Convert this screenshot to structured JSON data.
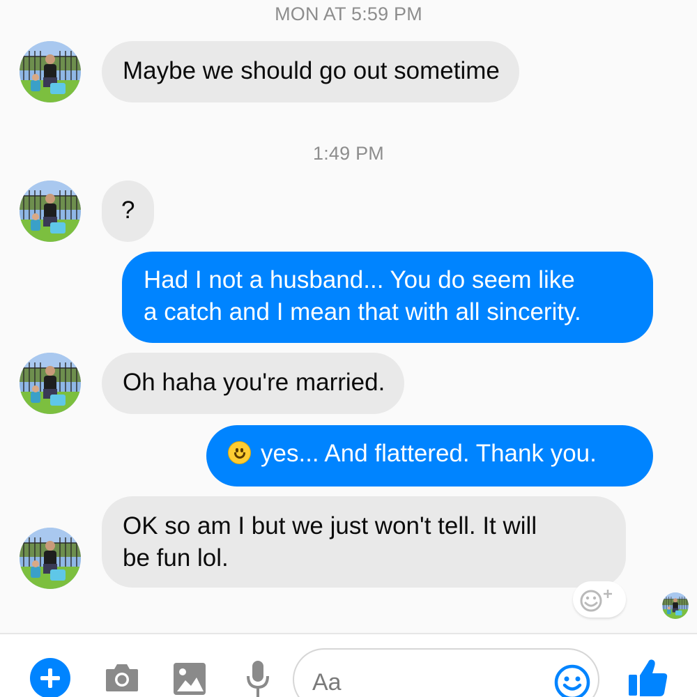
{
  "timestamps": {
    "first": "MON AT 5:59 PM",
    "second": "1:49 PM"
  },
  "messages": [
    {
      "from": "them",
      "lines": [
        "Maybe we should go out sometime"
      ]
    },
    {
      "from": "them",
      "lines": [
        "?"
      ]
    },
    {
      "from": "me",
      "lines": [
        "Had I not a husband... You do seem like",
        "a catch and I mean that with all sincerity."
      ]
    },
    {
      "from": "them",
      "lines": [
        "Oh haha you're married."
      ]
    },
    {
      "from": "me",
      "emoji": "slightly-smiling-face",
      "lines": [
        "yes... And flattered. Thank you."
      ]
    },
    {
      "from": "them",
      "lines": [
        "OK so am I but we just won't tell. It will",
        "be fun lol."
      ]
    }
  ],
  "composer": {
    "placeholder": "Aa",
    "icons": [
      "plus-icon",
      "camera-icon",
      "image-icon",
      "microphone-icon",
      "emoji-icon",
      "thumbs-up-icon"
    ]
  },
  "colors": {
    "accent": "#0084ff",
    "incoming_bubble": "#e9e9e9",
    "outgoing_bubble": "#0084ff",
    "timestamp": "#8d8d8d",
    "background": "#fafafa"
  }
}
